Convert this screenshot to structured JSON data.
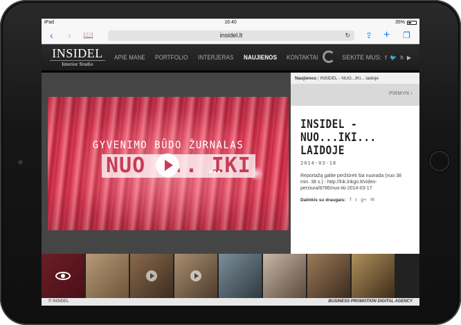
{
  "status_bar": {
    "carrier": "iPad",
    "time": "16:40",
    "battery": "35%"
  },
  "browser": {
    "url": "insidel.lt"
  },
  "site": {
    "logo_name": "INSIDEL",
    "logo_sub": "Interior Studio",
    "nav": [
      "APIE MANE",
      "PORTFOLIO",
      "INTERJERAS",
      "NAUJIENOS",
      "KONTAKTAI"
    ],
    "active_nav": "NAUJIENOS",
    "follow_label": "SEKITE MUS:",
    "follow_icons": [
      "facebook-icon",
      "twitter-icon",
      "houzz-icon",
      "youtube-icon"
    ]
  },
  "video": {
    "caption_top": "GYVENIMO BŪDO ŽURNALAS",
    "caption_main": "NUO ... IKI",
    "caption_dots": "..."
  },
  "breadcrumb": {
    "section": "Naujienos",
    "separator": "|",
    "current": "INSIDEL - NUO...IKI... laidoje"
  },
  "pager": {
    "next_label": "PIRMYN"
  },
  "article": {
    "title": "INSIDEL - NUO...IKI... LAIDOJE",
    "date": "2014-03-18",
    "body": "Reportažą galite peržiūrėti šia nuorada (nuo 38 min. 38 s.) - http://lnk.lnkgo.lt/video-perziura/8786/nuo-iki-2014-03-17",
    "share_label": "Dalinkis su draugais:",
    "share_icons": [
      "facebook-icon",
      "twitter-icon",
      "google-plus-icon",
      "email-icon"
    ]
  },
  "thumbnails": [
    {
      "name": "video-thumbnail",
      "colors": [
        "#6b1e26",
        "#4a0f18"
      ],
      "overlay": "eye"
    },
    {
      "name": "living-room-thumbnail",
      "colors": [
        "#b79a78",
        "#6e5439"
      ],
      "overlay": "none"
    },
    {
      "name": "bedroom-thumbnail",
      "colors": [
        "#8a6a4c",
        "#3c2c20"
      ],
      "overlay": "arrow"
    },
    {
      "name": "lounge-thumbnail",
      "colors": [
        "#a88e70",
        "#4d3c2d"
      ],
      "overlay": "arrow"
    },
    {
      "name": "bathroom-thumbnail",
      "colors": [
        "#7a8e99",
        "#2f3a41"
      ],
      "overlay": "none"
    },
    {
      "name": "bath-detail-thumbnail",
      "colors": [
        "#c6b7a7",
        "#5d4b3e"
      ],
      "overlay": "none"
    },
    {
      "name": "kitchen-thumbnail",
      "colors": [
        "#9c7a58",
        "#3b2b1e"
      ],
      "overlay": "none"
    },
    {
      "name": "dining-thumbnail",
      "colors": [
        "#b0905c",
        "#3f2d19"
      ],
      "overlay": "none"
    }
  ],
  "footer": {
    "copyright": "© INSIDEL",
    "agency": "BUSINESS PROMOTION DIGITAL AGENCY"
  }
}
